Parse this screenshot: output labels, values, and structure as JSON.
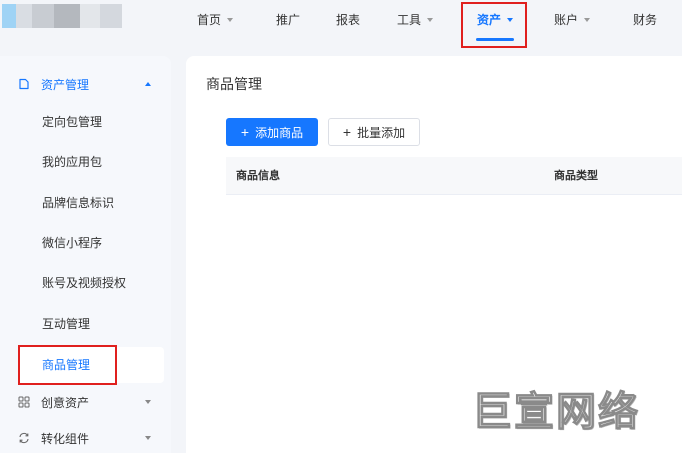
{
  "logo": {
    "colors": [
      "#9fd3f5",
      "#d9dde3",
      "#c8ccd2",
      "#b4b8be",
      "#e3e6ea",
      "#d4d8de"
    ]
  },
  "nav": {
    "items": [
      {
        "label": "首页",
        "has_caret": true
      },
      {
        "label": "推广",
        "has_caret": false
      },
      {
        "label": "报表",
        "has_caret": false
      },
      {
        "label": "工具",
        "has_caret": true
      },
      {
        "label": "资产",
        "has_caret": true,
        "active": true
      },
      {
        "label": "账户",
        "has_caret": true
      },
      {
        "label": "财务",
        "has_caret": false
      }
    ]
  },
  "sidebar": {
    "groups": [
      {
        "label": "资产管理",
        "icon": "asset-icon",
        "open": true
      },
      {
        "label": "创意资产",
        "icon": "grid-icon",
        "open": false
      },
      {
        "label": "转化组件",
        "icon": "convert-icon",
        "open": false
      }
    ],
    "items": [
      {
        "label": "定向包管理"
      },
      {
        "label": "我的应用包"
      },
      {
        "label": "品牌信息标识"
      },
      {
        "label": "微信小程序"
      },
      {
        "label": "账号及视频授权"
      },
      {
        "label": "互动管理"
      },
      {
        "label": "商品管理",
        "active": true
      }
    ]
  },
  "main": {
    "title": "商品管理",
    "add_button": "添加商品",
    "batch_button": "批量添加",
    "columns": [
      "商品信息",
      "商品类型"
    ]
  },
  "watermark": "巨宣网络",
  "colors": {
    "accent": "#1677ff",
    "highlight_box": "#e0201e"
  }
}
